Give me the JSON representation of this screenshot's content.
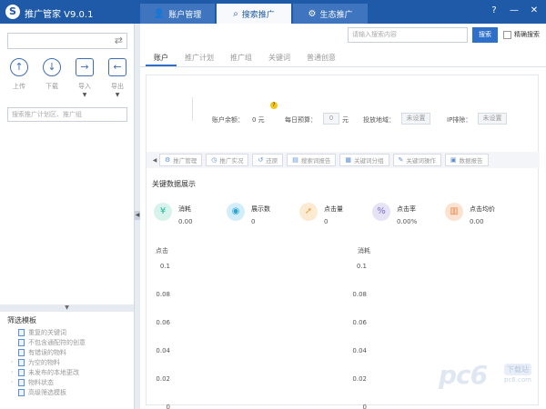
{
  "app": {
    "title": "推广管家 V9.0.1",
    "logo_letter": "S"
  },
  "main_tabs": [
    {
      "label": "账户管理",
      "icon": "user-icon"
    },
    {
      "label": "搜索推广",
      "icon": "search-icon"
    },
    {
      "label": "生态推广",
      "icon": "network-icon"
    }
  ],
  "window_controls": {
    "help": "?",
    "minimize": "—",
    "close": "✕"
  },
  "left_panel": {
    "account_placeholder": "",
    "tools": [
      {
        "label": "上传",
        "icon": "upload-icon"
      },
      {
        "label": "下载",
        "icon": "download-icon"
      },
      {
        "label": "导入",
        "icon": "import-icon"
      },
      {
        "label": "导出",
        "icon": "export-icon"
      }
    ],
    "search_placeholder": "搜索推广计划区、推广组",
    "filter_title": "筛选模板",
    "filters": [
      "重复的关键词",
      "不包含通配符的创意",
      "有错误的物料",
      "为空的物料",
      "未发布的本地更改",
      "物料状态",
      "高级筛选模板"
    ]
  },
  "search": {
    "placeholder": "请输入搜索内容",
    "button": "搜索",
    "exact_label": "精确搜索"
  },
  "sub_tabs": [
    "账户",
    "推广计划",
    "推广组",
    "关键词",
    "普通创意"
  ],
  "account_info": {
    "balance_label": "账户余额：",
    "balance_value": "0 元",
    "budget_label": "每日预算：",
    "budget_value": "0",
    "budget_unit": "元",
    "region_label": "投放地域：",
    "region_value": "未设置",
    "ip_label": "IP排除：",
    "ip_value": "未设置"
  },
  "toolbar": [
    "推广管理",
    "推广实况",
    "还原",
    "搜索词报告",
    "关键词分组",
    "关键词操作",
    "数据报告"
  ],
  "metrics_title": "关键数据展示",
  "metrics": [
    {
      "label": "消耗",
      "value": "0.00",
      "icon": "currency-icon",
      "color": "#1fb89a"
    },
    {
      "label": "展示数",
      "value": "0",
      "icon": "eye-icon",
      "color": "#2aa6d9"
    },
    {
      "label": "点击量",
      "value": "0",
      "icon": "cursor-icon",
      "color": "#e6a23c"
    },
    {
      "label": "点击率",
      "value": "0.00%",
      "icon": "percent-icon",
      "color": "#7b6fd0"
    },
    {
      "label": "点击均价",
      "value": "0.00",
      "icon": "chart-icon",
      "color": "#e98a4a"
    }
  ],
  "charts": [
    {
      "title": "点击",
      "yticks": [
        "0.1",
        "0.08",
        "0.06",
        "0.04",
        "0.02",
        "0"
      ]
    },
    {
      "title": "消耗",
      "yticks": [
        "0.1",
        "0.08",
        "0.06",
        "0.04",
        "0.02",
        "0"
      ]
    }
  ],
  "watermark": {
    "brand": "pc6",
    "badge": "下载站",
    "sub": "pc6.com"
  }
}
